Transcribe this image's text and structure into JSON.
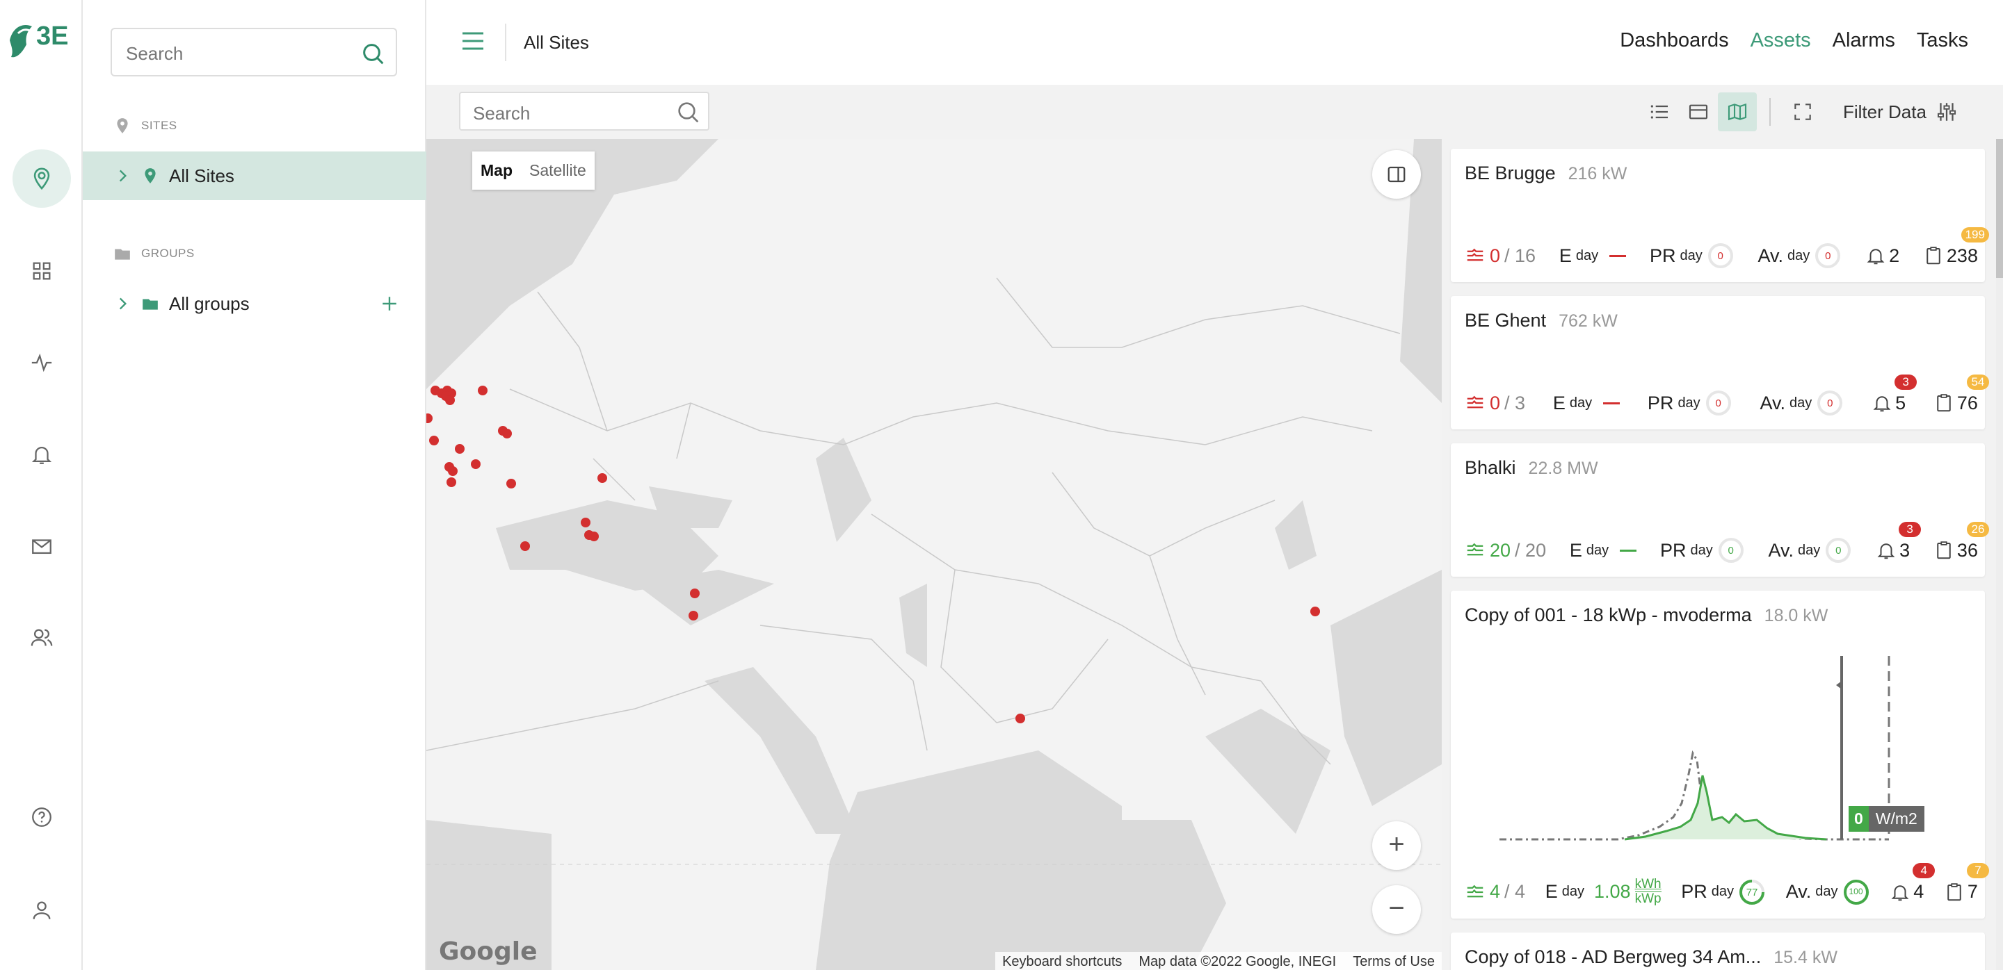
{
  "logo": {
    "text": "3E"
  },
  "sidebar": {
    "search_placeholder": "Search",
    "sites_label": "SITES",
    "all_sites": "All Sites",
    "groups_label": "GROUPS",
    "all_groups": "All groups"
  },
  "header": {
    "page_title": "All Sites",
    "nav": [
      "Dashboards",
      "Assets",
      "Alarms",
      "Tasks"
    ],
    "active_nav": "Assets"
  },
  "toolbar": {
    "search_placeholder": "Search",
    "filter_label": "Filter Data"
  },
  "map": {
    "type_map": "Map",
    "type_satellite": "Satellite",
    "zoom_in": "+",
    "zoom_out": "−",
    "logo": "Google",
    "attribution": [
      "Keyboard shortcuts",
      "Map data ©2022 Google, INEGI",
      "Terms of Use"
    ]
  },
  "sites": [
    {
      "name": "BE Brugge",
      "power": "216 kW",
      "status": "0",
      "total": "/ 16",
      "eday_symbol": "E",
      "eday_sub": "day",
      "pr": "PR",
      "pr_sub": "day",
      "pr_val": "0",
      "av": "Av.",
      "av_sub": "day",
      "av_val": "0",
      "alarms": "2",
      "alarm_badge": "",
      "tasks": "238",
      "task_badge": "199",
      "color": "#d32f2f"
    },
    {
      "name": "BE Ghent",
      "power": "762 kW",
      "status": "0",
      "total": "/ 3",
      "eday_symbol": "E",
      "eday_sub": "day",
      "pr": "PR",
      "pr_sub": "day",
      "pr_val": "0",
      "av": "Av.",
      "av_sub": "day",
      "av_val": "0",
      "alarms": "5",
      "alarm_badge": "3",
      "tasks": "76",
      "task_badge": "54",
      "color": "#d32f2f"
    },
    {
      "name": "Bhalki",
      "power": "22.8 MW",
      "status": "20",
      "total": "/ 20",
      "eday_symbol": "E",
      "eday_sub": "day",
      "pr": "PR",
      "pr_sub": "day",
      "pr_val": "0",
      "av": "Av.",
      "av_sub": "day",
      "av_val": "0",
      "alarms": "3",
      "alarm_badge": "3",
      "tasks": "36",
      "task_badge": "26",
      "color": "#43a847"
    },
    {
      "name": "Copy of 001 - 18 kWp - mvoderma",
      "power": "18.0 kW",
      "status": "4",
      "total": "/ 4",
      "eday_symbol": "E",
      "eday_sub": "day",
      "eday_val": "1.08",
      "eday_unit_top": "kWh",
      "eday_unit_bot": "kWp",
      "pr": "PR",
      "pr_sub": "day",
      "pr_val": "77",
      "av": "Av.",
      "av_sub": "day",
      "av_val": "100",
      "alarms": "4",
      "alarm_badge": "4",
      "tasks": "7",
      "task_badge": "7",
      "color": "#43a847",
      "irradiance_value": "0",
      "irradiance_unit": "W/m2"
    },
    {
      "name": "Copy of 018 - AD Bergweg 34 Am...",
      "power": "15.4 kW"
    }
  ],
  "colors": {
    "accent": "#3d9a78",
    "red": "#d32f2f",
    "green": "#43a847",
    "yellow": "#f5b942"
  }
}
